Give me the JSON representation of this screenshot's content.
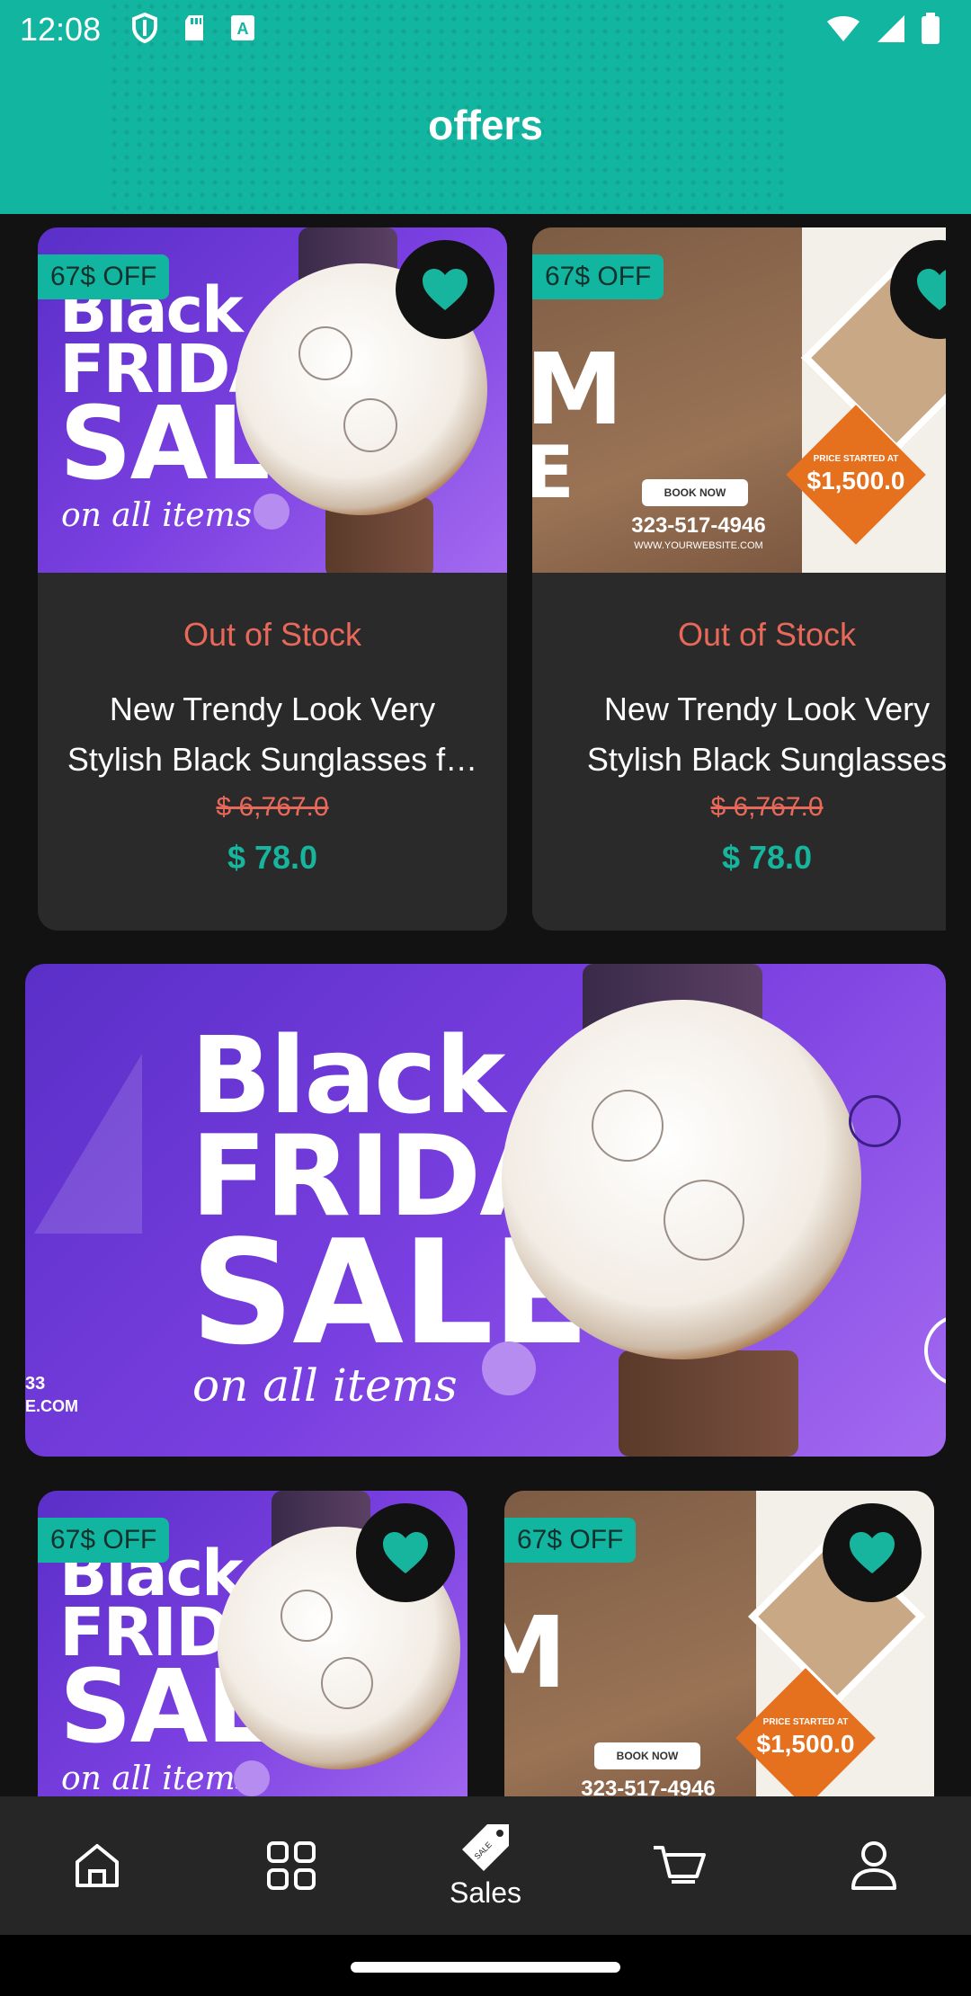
{
  "status_bar": {
    "time": "12:08"
  },
  "header": {
    "title": "offers"
  },
  "products_row1": [
    {
      "discount": "67$ OFF",
      "stock": "Out of Stock",
      "name_line1": "New Trendy Look Very",
      "name_line2": "Stylish Black Sunglasses f…",
      "old_price": "$ 6,767.0",
      "new_price": "$ 78.0",
      "promo": "Black Friday Sale",
      "favorite": true
    },
    {
      "discount": "67$ OFF",
      "stock": "Out of Stock",
      "name_line1": "New Trendy Look Very",
      "name_line2": "Stylish Black Sunglasses",
      "old_price": "$ 6,767.0",
      "new_price": "$ 78.0",
      "promo": "Book Now",
      "favorite": true
    }
  ],
  "banner": {
    "line1": "Black",
    "line2": "FRIDAY",
    "line3": "SALE",
    "script": "on all items",
    "side_text_1": "33",
    "side_text_2": "E.COM"
  },
  "products_row2": [
    {
      "discount": "67$ OFF",
      "favorite": true
    },
    {
      "discount": "67$ OFF",
      "favorite": true
    }
  ],
  "promo_art": {
    "sale_line1": "Black",
    "sale_line2": "FRIDAY",
    "sale_line3": "SALE",
    "sale_script": "on all items",
    "book_now": "BOOK NOW",
    "phone": "323-517-4946",
    "website": "WWW.YOURWEBSITE.COM",
    "price_caption": "PRICE STARTED AT",
    "price": "$1,500.0",
    "letter_m": "M",
    "letter_e": "E"
  },
  "bottom_nav": [
    {
      "label": "",
      "icon": "home-icon"
    },
    {
      "label": "",
      "icon": "categories-icon"
    },
    {
      "label": "Sales",
      "icon": "sale-tag-icon",
      "active": true
    },
    {
      "label": "",
      "icon": "cart-icon"
    },
    {
      "label": "",
      "icon": "profile-icon"
    }
  ],
  "colors": {
    "accent": "#12b5a0",
    "price": "#17b59d",
    "out_of_stock": "#e8685a",
    "background": "#121212",
    "card": "#2a2a2a"
  }
}
